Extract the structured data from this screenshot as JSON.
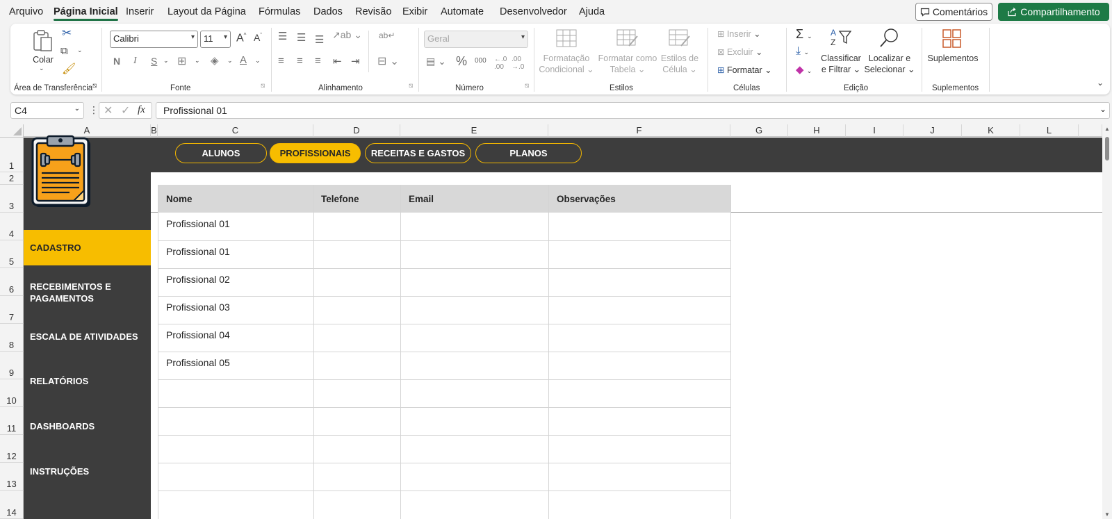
{
  "menu": {
    "tabs": [
      "Arquivo",
      "Página Inicial",
      "Inserir",
      "Layout da Página",
      "Fórmulas",
      "Dados",
      "Revisão",
      "Exibir",
      "Automate",
      "Desenvolvedor",
      "Ajuda"
    ],
    "active_tab": "Página Inicial",
    "comments_label": "Comentários",
    "share_label": "Compartilhamento",
    "accent_color": "#1d7a46"
  },
  "ribbon": {
    "clipboard": {
      "paste_label": "Colar",
      "group_label": "Área de Transferência"
    },
    "font": {
      "font_name": "Calibri",
      "font_size": "11",
      "bold": "N",
      "italic": "I",
      "underline": "S",
      "group_label": "Fonte"
    },
    "alignment": {
      "group_label": "Alinhamento"
    },
    "number": {
      "format": "Geral",
      "group_label": "Número"
    },
    "styles": {
      "conditional": [
        "Formatação",
        "Condicional"
      ],
      "table": [
        "Formatar como",
        "Tabela"
      ],
      "cell": [
        "Estilos de",
        "Célula"
      ],
      "group_label": "Estilos"
    },
    "cells": {
      "insert": "Inserir",
      "delete": "Excluir",
      "format": "Formatar",
      "group_label": "Células"
    },
    "editing": {
      "sort": [
        "Classificar",
        "e Filtrar"
      ],
      "find": [
        "Localizar e",
        "Selecionar"
      ],
      "group_label": "Edição"
    },
    "addins": {
      "label": "Suplementos",
      "group_label": "Suplementos"
    }
  },
  "formula_bar": {
    "name_box": "C4",
    "fx": "fx",
    "content": "Profissional 01"
  },
  "columns": [
    "A",
    "B",
    "C",
    "D",
    "E",
    "F",
    "G",
    "H",
    "I",
    "J",
    "K",
    "L"
  ],
  "rows": [
    "1",
    "2",
    "3",
    "4",
    "5",
    "6",
    "7",
    "8",
    "9",
    "10",
    "11",
    "12",
    "13",
    "14"
  ],
  "top_nav": {
    "items": [
      "ALUNOS",
      "PROFISSIONAIS",
      "RECEITAS E GASTOS",
      "PLANOS"
    ],
    "active": "PROFISSIONAIS"
  },
  "side_nav": {
    "items": [
      "CADASTRO",
      "RECEBIMENTOS E PAGAMENTOS",
      "ESCALA DE ATIVIDADES",
      "RELATÓRIOS",
      "DASHBOARDS",
      "INSTRUÇÕES"
    ],
    "active": "CADASTRO"
  },
  "table": {
    "headers": [
      "Nome",
      "Telefone",
      "Email",
      "Observações"
    ],
    "rows": [
      "Profissional 01",
      "Profissional 01",
      "Profissional 02",
      "Profissional 03",
      "Profissional 04",
      "Profissional 05"
    ]
  },
  "theme": {
    "dark": "#3d3d3d",
    "highlight": "#f7bd00"
  }
}
